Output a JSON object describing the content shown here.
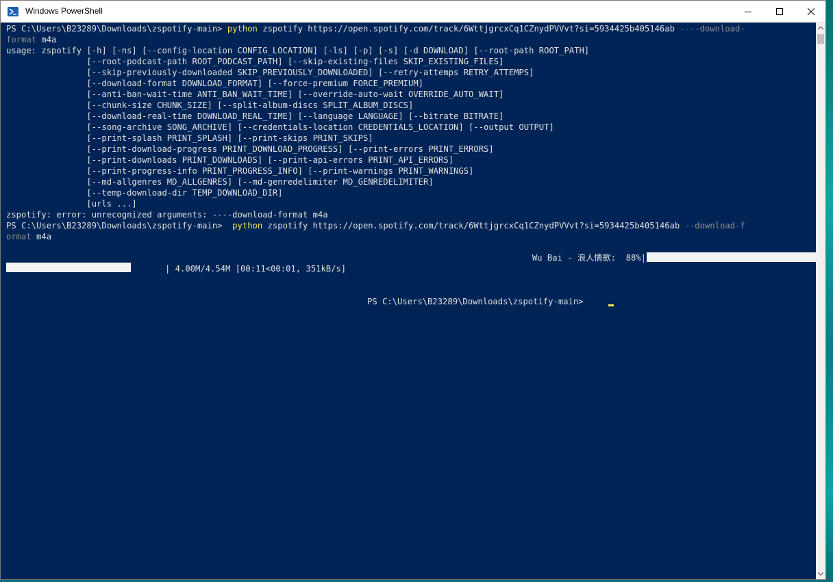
{
  "window": {
    "title": "Windows PowerShell",
    "icon": "powershell-icon",
    "controls": {
      "minimize": "minimize-icon",
      "maximize": "maximize-icon",
      "close": "close-icon"
    }
  },
  "colors": {
    "console_background": "#012456",
    "console_text": "#e0e0e0",
    "command_highlight": "#f4e84c",
    "argument_dim": "#8e8e8e"
  },
  "console": {
    "cmd1": {
      "prompt": "PS C:\\Users\\B23289\\Downloads\\zspotify-main> ",
      "command": "python",
      "args": " zspotify https://open.spotify.com/track/6WttjgrcxCq1CZnydPVVvt?si=5934425b405146ab ",
      "flag_part1": "----download-",
      "flag_part2": "format",
      "flag_value": " m4a"
    },
    "usage_lines": [
      "usage: zspotify [-h] [-ns] [--config-location CONFIG_LOCATION] [-ls] [-p] [-s] [-d DOWNLOAD] [--root-path ROOT_PATH]",
      "                [--root-podcast-path ROOT_PODCAST_PATH] [--skip-existing-files SKIP_EXISTING_FILES]",
      "                [--skip-previously-downloaded SKIP_PREVIOUSLY_DOWNLOADED] [--retry-attemps RETRY_ATTEMPS]",
      "                [--download-format DOWNLOAD_FORMAT] [--force-premium FORCE_PREMIUM]",
      "                [--anti-ban-wait-time ANTI_BAN_WAIT_TIME] [--override-auto-wait OVERRIDE_AUTO_WAIT]",
      "                [--chunk-size CHUNK_SIZE] [--split-album-discs SPLIT_ALBUM_DISCS]",
      "                [--download-real-time DOWNLOAD_REAL_TIME] [--language LANGUAGE] [--bitrate BITRATE]",
      "                [--song-archive SONG_ARCHIVE] [--credentials-location CREDENTIALS_LOCATION] [--output OUTPUT]",
      "                [--print-splash PRINT_SPLASH] [--print-skips PRINT_SKIPS]",
      "                [--print-download-progress PRINT_DOWNLOAD_PROGRESS] [--print-errors PRINT_ERRORS]",
      "                [--print-downloads PRINT_DOWNLOADS] [--print-api-errors PRINT_API_ERRORS]",
      "                [--print-progress-info PRINT_PROGRESS_INFO] [--print-warnings PRINT_WARNINGS]",
      "                [--md-allgenres MD_ALLGENRES] [--md-genredelimiter MD_GENREDELIMITER]",
      "                [--temp-download-dir TEMP_DOWNLOAD_DIR]",
      "                [urls ...]"
    ],
    "error_line": "zspotify: error: unrecognized arguments: ----download-format m4a",
    "cmd2": {
      "prompt": "PS C:\\Users\\B23289\\Downloads\\zspotify-main>  ",
      "command": "python",
      "args": " zspotify https://open.spotify.com/track/6WttjgrcxCq1CZnydPVVvt?si=5934425b405146ab ",
      "flag_part1": "--download-f",
      "flag_part2": "ormat",
      "flag_value": " m4a"
    },
    "progress": {
      "label": "Wu Bai - 浪人情歌:  88%|",
      "percent": 88,
      "stats": "| 4.00M/4.54M [00:11<00:01, 351kB/s]"
    },
    "final_prompt": "PS C:\\Users\\B23289\\Downloads\\zspotify-main> "
  }
}
